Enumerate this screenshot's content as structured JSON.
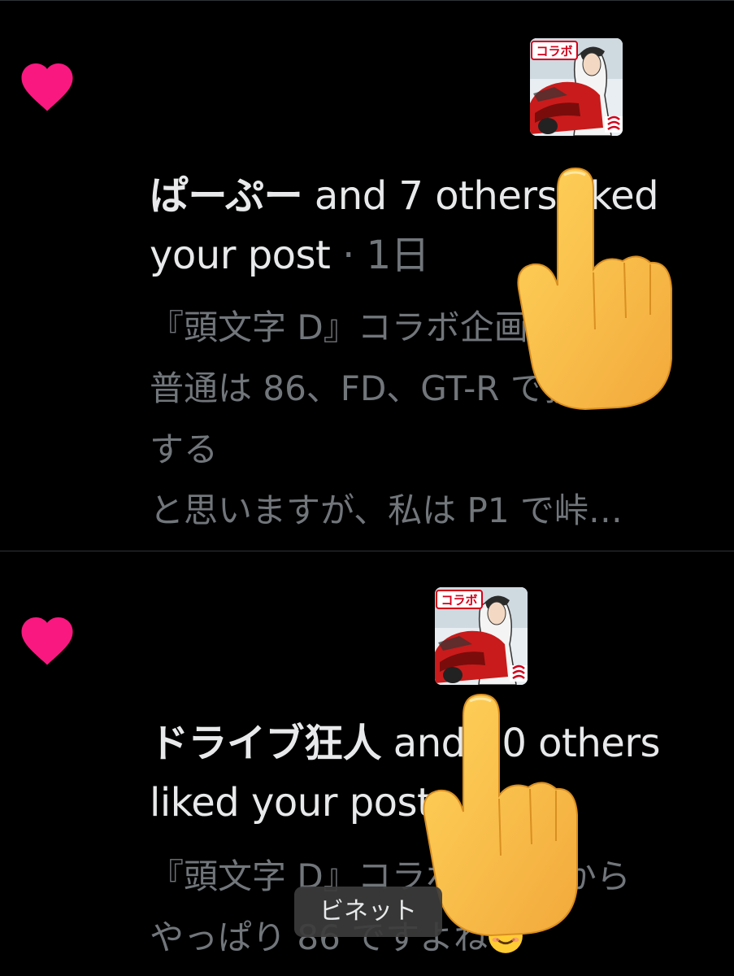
{
  "notifications": [
    {
      "user": "ぱーぷー",
      "action": " and 7 others liked your post",
      "separator": " · ",
      "time": "1日",
      "avatar_badge": "コラボ",
      "snippet_lines": [
        "『頭文字 D』コラボ企画だから",
        "普通は 86、FD、GT-R で投稿",
        "する",
        "と思いますが、私は P1 で峠…"
      ]
    },
    {
      "user": "ドライブ狂人",
      "action": " and 10 others liked your post",
      "separator": "",
      "time": "",
      "avatar_badge": "コラボ",
      "snippet_lines": [
        "『頭文字 D』コラボ企画だから",
        "やっぱり 86 ですよね",
        ""
      ]
    }
  ],
  "toast": {
    "label": "ビネット"
  },
  "icons": {
    "like": "heart-icon",
    "pointer": "pointing-hand-emoji",
    "smile": "smiling-face-emoji"
  },
  "colors": {
    "background": "#000000",
    "heart": "#f91880",
    "primary_text": "#e7e9ea",
    "secondary_text": "#71767b"
  }
}
